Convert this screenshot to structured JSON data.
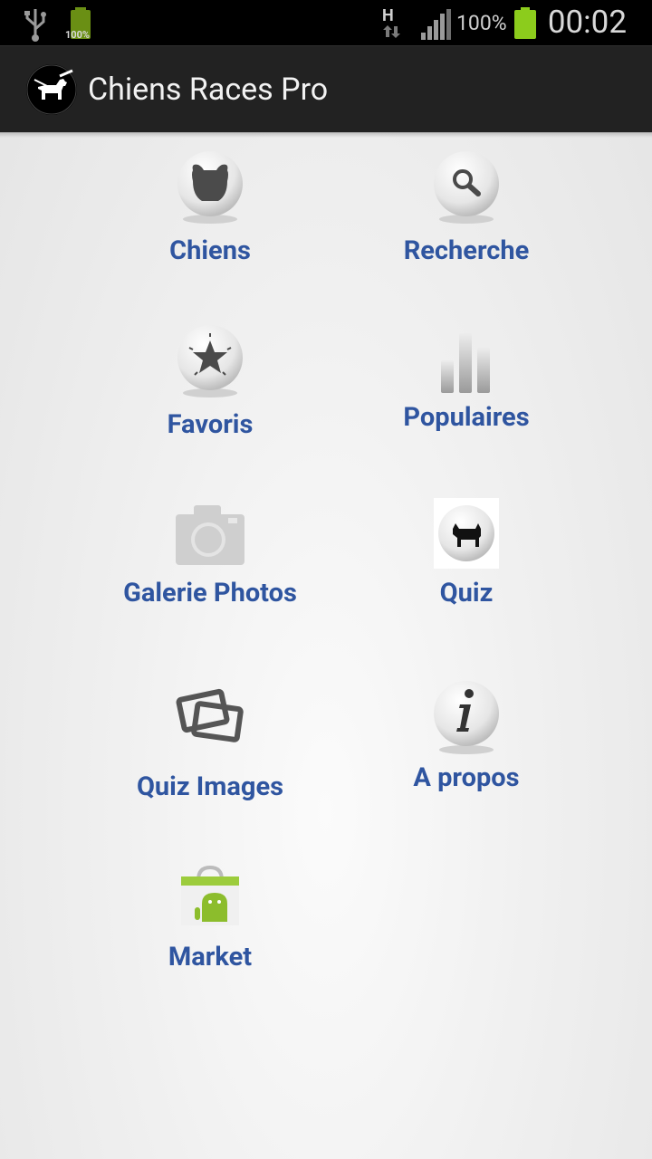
{
  "status_bar": {
    "battery_small_label": "100%",
    "network_type": "H",
    "battery_percent": "100%",
    "time": "00:02"
  },
  "action_bar": {
    "title": "Chiens Races Pro"
  },
  "menu": {
    "chiens": "Chiens",
    "recherche": "Recherche",
    "favoris": "Favoris",
    "populaires": "Populaires",
    "galerie": "Galerie Photos",
    "quiz": "Quiz",
    "quiz_images": "Quiz Images",
    "apropos": "A propos",
    "market": "Market"
  },
  "colors": {
    "label": "#2f55a0",
    "battery": "#8ccc1c",
    "action_bar": "#222222"
  }
}
